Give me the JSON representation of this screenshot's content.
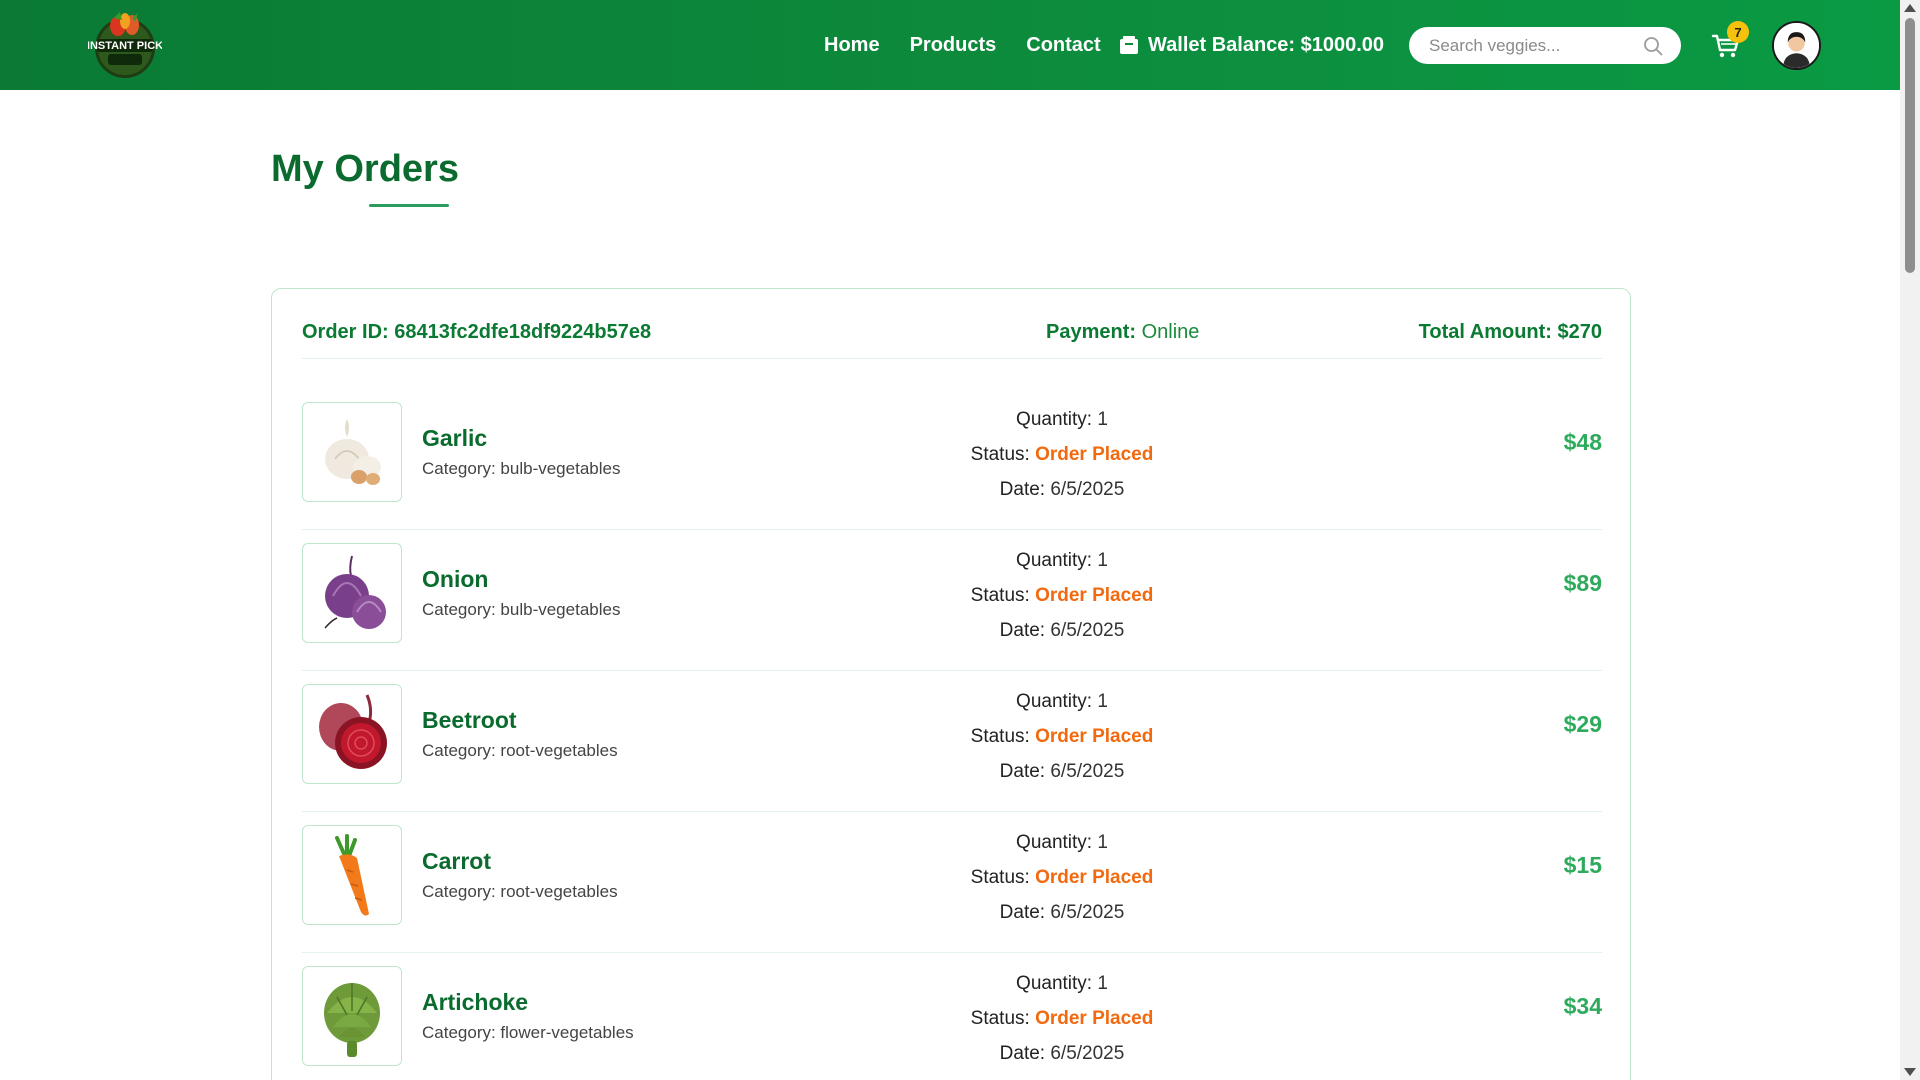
{
  "header": {
    "logo_text": "INSTANT PICK",
    "nav": [
      {
        "label": "Home"
      },
      {
        "label": "Products"
      },
      {
        "label": "Contact"
      }
    ],
    "wallet_label": "Wallet Balance: $1000.00",
    "search_placeholder": "Search veggies...",
    "cart_count": "7",
    "brand_color": "#0b8a3c"
  },
  "page": {
    "title": "My Orders"
  },
  "order": {
    "id_text": "Order ID: 68413fc2dfe18df9224b57e8",
    "payment_label": "Payment:",
    "payment_value": "Online",
    "total_text": "Total Amount: $270",
    "items": [
      {
        "name": "Garlic",
        "category_label": "Category: bulb-vegetables",
        "quantity_label": "Quantity:",
        "quantity": "1",
        "status_label": "Status:",
        "status": "Order Placed",
        "date_label": "Date:",
        "date": "6/5/2025",
        "price": "$48",
        "icon": "garlic-icon"
      },
      {
        "name": "Onion",
        "category_label": "Category: bulb-vegetables",
        "quantity_label": "Quantity:",
        "quantity": "1",
        "status_label": "Status:",
        "status": "Order Placed",
        "date_label": "Date:",
        "date": "6/5/2025",
        "price": "$89",
        "icon": "onion-icon"
      },
      {
        "name": "Beetroot",
        "category_label": "Category: root-vegetables",
        "quantity_label": "Quantity:",
        "quantity": "1",
        "status_label": "Status:",
        "status": "Order Placed",
        "date_label": "Date:",
        "date": "6/5/2025",
        "price": "$29",
        "icon": "beetroot-icon"
      },
      {
        "name": "Carrot",
        "category_label": "Category: root-vegetables",
        "quantity_label": "Quantity:",
        "quantity": "1",
        "status_label": "Status:",
        "status": "Order Placed",
        "date_label": "Date:",
        "date": "6/5/2025",
        "price": "$15",
        "icon": "carrot-icon"
      },
      {
        "name": "Artichoke",
        "category_label": "Category: flower-vegetables",
        "quantity_label": "Quantity:",
        "quantity": "1",
        "status_label": "Status:",
        "status": "Order Placed",
        "date_label": "Date:",
        "date": "6/5/2025",
        "price": "$34",
        "icon": "artichoke-icon"
      }
    ]
  }
}
